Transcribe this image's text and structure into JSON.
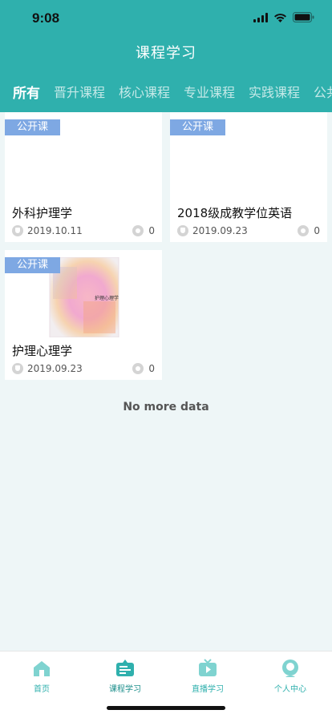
{
  "status": {
    "time": "9:08"
  },
  "header": {
    "title": "课程学习"
  },
  "tabs": [
    {
      "label": "所有",
      "active": true
    },
    {
      "label": "晋升课程",
      "active": false
    },
    {
      "label": "核心课程",
      "active": false
    },
    {
      "label": "专业课程",
      "active": false
    },
    {
      "label": "实践课程",
      "active": false
    },
    {
      "label": "公共",
      "active": false
    }
  ],
  "courses": [
    {
      "badge": "公开课",
      "title": "外科护理学",
      "date": "2019.10.11",
      "count": "0",
      "has_cover": false
    },
    {
      "badge": "公开课",
      "title": "2018级成教学位英语",
      "date": "2019.09.23",
      "count": "0",
      "has_cover": false
    },
    {
      "badge": "公开课",
      "title": "护理心理学",
      "date": "2019.09.23",
      "count": "0",
      "has_cover": true,
      "cover_text": "护理心理学"
    }
  ],
  "list_footer": "No more data",
  "bottom_nav": [
    {
      "label": "首页",
      "icon": "home-icon",
      "active": false
    },
    {
      "label": "课程学习",
      "icon": "course-icon",
      "active": true
    },
    {
      "label": "直播学习",
      "icon": "tv-icon",
      "active": false
    },
    {
      "label": "个人中心",
      "icon": "person-icon",
      "active": false
    }
  ],
  "colors": {
    "primary": "#2fb0ad",
    "badge": "#7ea8e3",
    "background": "#eef6f7"
  }
}
